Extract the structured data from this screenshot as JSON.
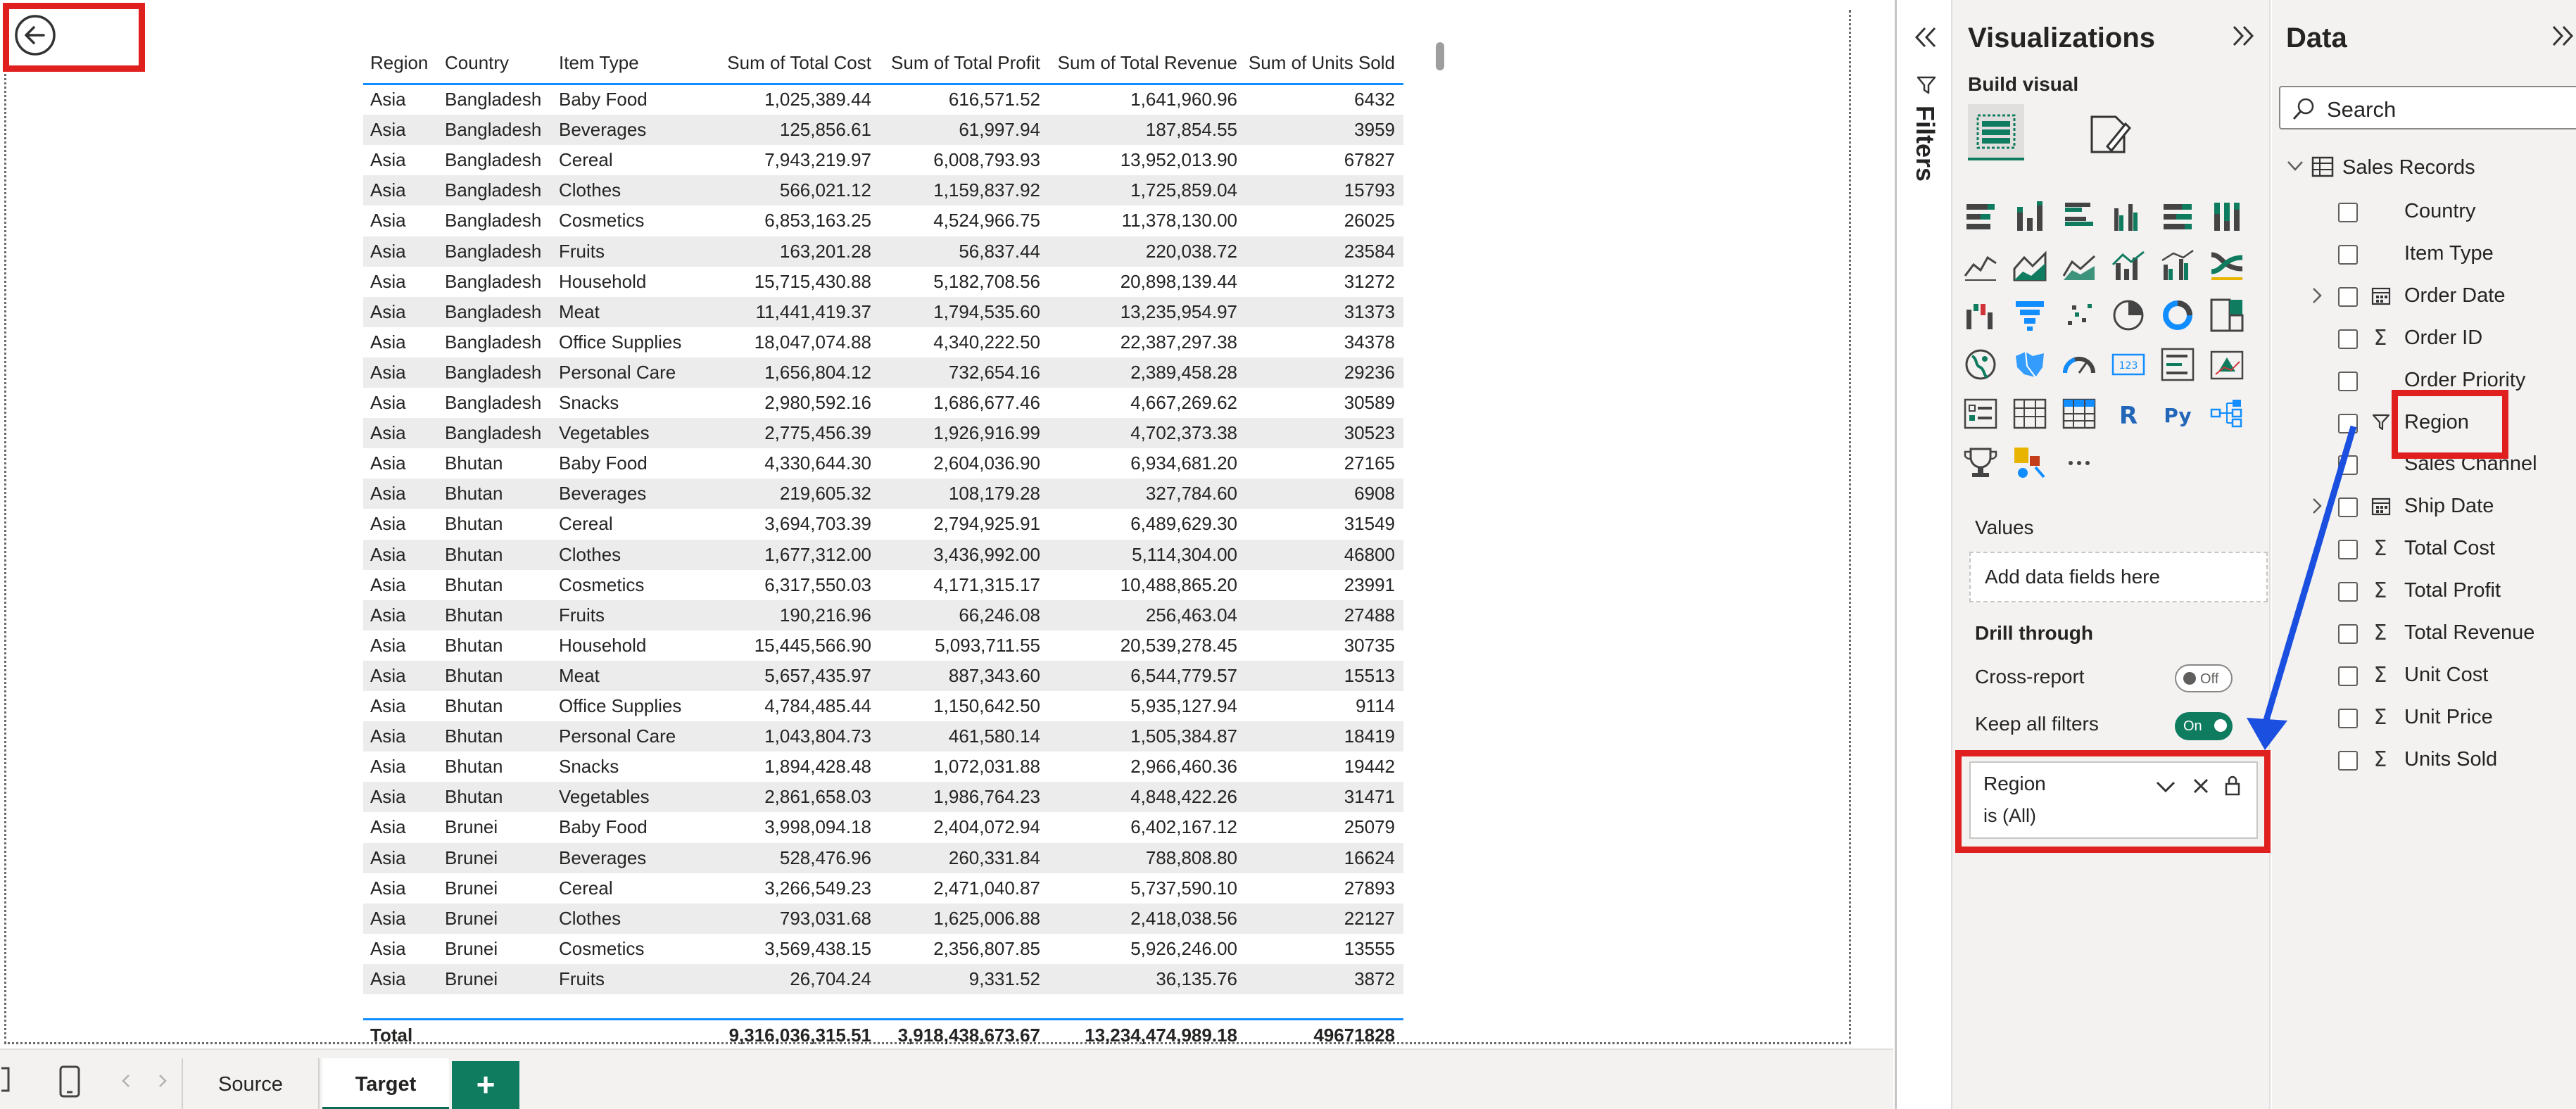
{
  "canvas": {
    "back_icon": "back-arrow-circle-icon"
  },
  "table": {
    "headers": [
      "Region",
      "Country",
      "Item Type",
      "Sum of Total Cost",
      "Sum of Total Profit",
      "Sum of Total Revenue",
      "Sum of Units Sold"
    ],
    "rows": [
      [
        "Asia",
        "Bangladesh",
        "Baby Food",
        "1,025,389.44",
        "616,571.52",
        "1,641,960.96",
        "6432"
      ],
      [
        "Asia",
        "Bangladesh",
        "Beverages",
        "125,856.61",
        "61,997.94",
        "187,854.55",
        "3959"
      ],
      [
        "Asia",
        "Bangladesh",
        "Cereal",
        "7,943,219.97",
        "6,008,793.93",
        "13,952,013.90",
        "67827"
      ],
      [
        "Asia",
        "Bangladesh",
        "Clothes",
        "566,021.12",
        "1,159,837.92",
        "1,725,859.04",
        "15793"
      ],
      [
        "Asia",
        "Bangladesh",
        "Cosmetics",
        "6,853,163.25",
        "4,524,966.75",
        "11,378,130.00",
        "26025"
      ],
      [
        "Asia",
        "Bangladesh",
        "Fruits",
        "163,201.28",
        "56,837.44",
        "220,038.72",
        "23584"
      ],
      [
        "Asia",
        "Bangladesh",
        "Household",
        "15,715,430.88",
        "5,182,708.56",
        "20,898,139.44",
        "31272"
      ],
      [
        "Asia",
        "Bangladesh",
        "Meat",
        "11,441,419.37",
        "1,794,535.60",
        "13,235,954.97",
        "31373"
      ],
      [
        "Asia",
        "Bangladesh",
        "Office Supplies",
        "18,047,074.88",
        "4,340,222.50",
        "22,387,297.38",
        "34378"
      ],
      [
        "Asia",
        "Bangladesh",
        "Personal Care",
        "1,656,804.12",
        "732,654.16",
        "2,389,458.28",
        "29236"
      ],
      [
        "Asia",
        "Bangladesh",
        "Snacks",
        "2,980,592.16",
        "1,686,677.46",
        "4,667,269.62",
        "30589"
      ],
      [
        "Asia",
        "Bangladesh",
        "Vegetables",
        "2,775,456.39",
        "1,926,916.99",
        "4,702,373.38",
        "30523"
      ],
      [
        "Asia",
        "Bhutan",
        "Baby Food",
        "4,330,644.30",
        "2,604,036.90",
        "6,934,681.20",
        "27165"
      ],
      [
        "Asia",
        "Bhutan",
        "Beverages",
        "219,605.32",
        "108,179.28",
        "327,784.60",
        "6908"
      ],
      [
        "Asia",
        "Bhutan",
        "Cereal",
        "3,694,703.39",
        "2,794,925.91",
        "6,489,629.30",
        "31549"
      ],
      [
        "Asia",
        "Bhutan",
        "Clothes",
        "1,677,312.00",
        "3,436,992.00",
        "5,114,304.00",
        "46800"
      ],
      [
        "Asia",
        "Bhutan",
        "Cosmetics",
        "6,317,550.03",
        "4,171,315.17",
        "10,488,865.20",
        "23991"
      ],
      [
        "Asia",
        "Bhutan",
        "Fruits",
        "190,216.96",
        "66,246.08",
        "256,463.04",
        "27488"
      ],
      [
        "Asia",
        "Bhutan",
        "Household",
        "15,445,566.90",
        "5,093,711.55",
        "20,539,278.45",
        "30735"
      ],
      [
        "Asia",
        "Bhutan",
        "Meat",
        "5,657,435.97",
        "887,343.60",
        "6,544,779.57",
        "15513"
      ],
      [
        "Asia",
        "Bhutan",
        "Office Supplies",
        "4,784,485.44",
        "1,150,642.50",
        "5,935,127.94",
        "9114"
      ],
      [
        "Asia",
        "Bhutan",
        "Personal Care",
        "1,043,804.73",
        "461,580.14",
        "1,505,384.87",
        "18419"
      ],
      [
        "Asia",
        "Bhutan",
        "Snacks",
        "1,894,428.48",
        "1,072,031.88",
        "2,966,460.36",
        "19442"
      ],
      [
        "Asia",
        "Bhutan",
        "Vegetables",
        "2,861,658.03",
        "1,986,764.23",
        "4,848,422.26",
        "31471"
      ],
      [
        "Asia",
        "Brunei",
        "Baby Food",
        "3,998,094.18",
        "2,404,072.94",
        "6,402,167.12",
        "25079"
      ],
      [
        "Asia",
        "Brunei",
        "Beverages",
        "528,476.96",
        "260,331.84",
        "788,808.80",
        "16624"
      ],
      [
        "Asia",
        "Brunei",
        "Cereal",
        "3,266,549.23",
        "2,471,040.87",
        "5,737,590.10",
        "27893"
      ],
      [
        "Asia",
        "Brunei",
        "Clothes",
        "793,031.68",
        "1,625,006.88",
        "2,418,038.56",
        "22127"
      ],
      [
        "Asia",
        "Brunei",
        "Cosmetics",
        "3,569,438.15",
        "2,356,807.85",
        "5,926,246.00",
        "13555"
      ],
      [
        "Asia",
        "Brunei",
        "Fruits",
        "26,704.24",
        "9,331.52",
        "36,135.76",
        "3872"
      ]
    ],
    "total": [
      "Total",
      "",
      "",
      "9,316,036,315.51",
      "3,918,438,673.67",
      "13,234,474,989.18",
      "49671828"
    ]
  },
  "tabbar": {
    "source": "Source",
    "target": "Target",
    "add": "+"
  },
  "filters": {
    "label": "Filters"
  },
  "viz": {
    "title": "Visualizations",
    "build_visual": "Build visual",
    "values_label": "Values",
    "values_placeholder": "Add data fields here",
    "drill_through": "Drill through",
    "cross_report": "Cross-report",
    "cross_report_state": "Off",
    "keep_all_filters": "Keep all filters",
    "keep_all_filters_state": "On",
    "filter_card": {
      "field": "Region",
      "condition": "is (All)"
    },
    "visual_icons": [
      "stacked-bar-icon",
      "stacked-column-icon",
      "clustered-bar-icon",
      "clustered-column-icon",
      "100-bar-icon",
      "100-column-icon",
      "line-chart-icon",
      "area-chart-icon",
      "stacked-area-icon",
      "line-column-icon",
      "line-clustered-column-icon",
      "ribbon-chart-icon",
      "waterfall-icon",
      "funnel-icon",
      "scatter-icon",
      "pie-chart-icon",
      "donut-chart-icon",
      "treemap-icon",
      "map-icon",
      "filled-map-icon",
      "gauge-icon",
      "card-icon",
      "multi-row-card-icon",
      "kpi-icon",
      "slicer-icon",
      "table-icon",
      "matrix-icon",
      "r-visual-icon",
      "python-visual-icon",
      "decomposition-tree-icon",
      "key-influencers-icon",
      "qa-icon",
      "more-visuals-icon"
    ]
  },
  "data": {
    "title": "Data",
    "search_placeholder": "Search",
    "table_name": "Sales Records",
    "fields": [
      {
        "name": "Country",
        "icon": "",
        "expandable": false
      },
      {
        "name": "Item Type",
        "icon": "",
        "expandable": false
      },
      {
        "name": "Order Date",
        "icon": "calendar-icon",
        "expandable": true
      },
      {
        "name": "Order ID",
        "icon": "sigma-icon",
        "expandable": false
      },
      {
        "name": "Order Priority",
        "icon": "",
        "expandable": false
      },
      {
        "name": "Region",
        "icon": "filter-icon",
        "expandable": false
      },
      {
        "name": "Sales Channel",
        "icon": "",
        "expandable": false
      },
      {
        "name": "Ship Date",
        "icon": "calendar-icon",
        "expandable": true
      },
      {
        "name": "Total Cost",
        "icon": "sigma-icon",
        "expandable": false
      },
      {
        "name": "Total Profit",
        "icon": "sigma-icon",
        "expandable": false
      },
      {
        "name": "Total Revenue",
        "icon": "sigma-icon",
        "expandable": false
      },
      {
        "name": "Unit Cost",
        "icon": "sigma-icon",
        "expandable": false
      },
      {
        "name": "Unit Price",
        "icon": "sigma-icon",
        "expandable": false
      },
      {
        "name": "Units Sold",
        "icon": "sigma-icon",
        "expandable": false
      }
    ]
  },
  "colors": {
    "highlight": "#e0201f",
    "arrow": "#1a4fe0",
    "accent": "#0f7b5f",
    "table_line": "#118dff"
  }
}
